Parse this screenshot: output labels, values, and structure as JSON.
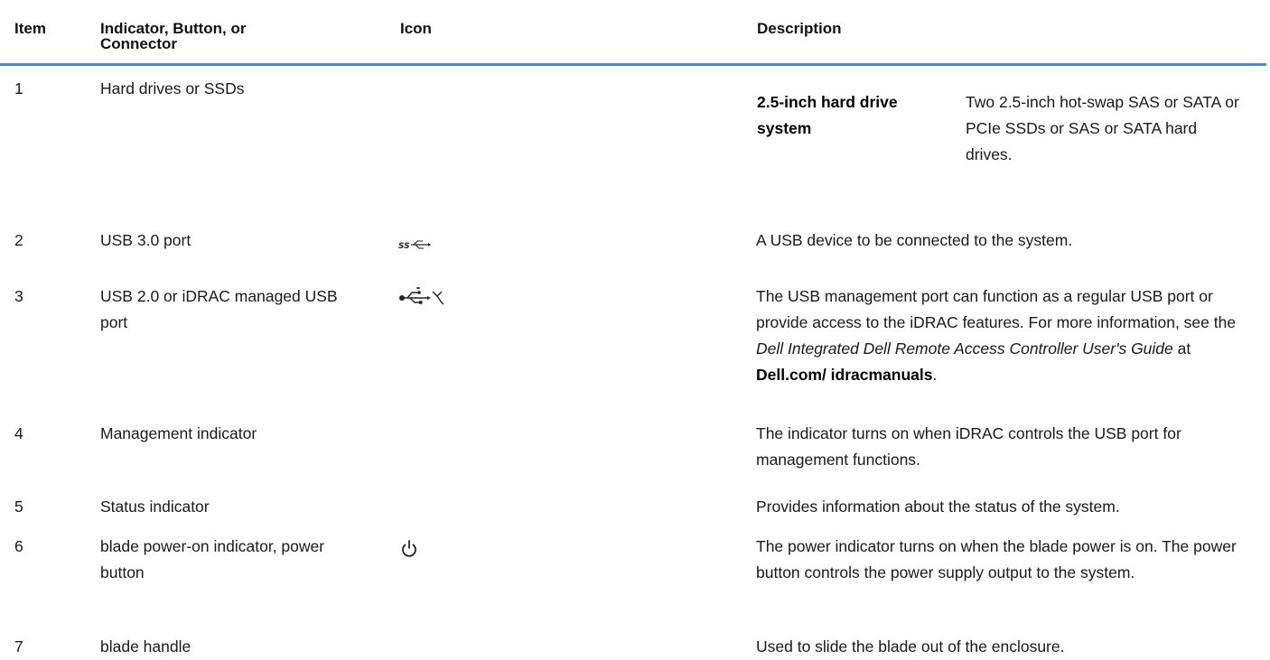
{
  "headers": {
    "item": "Item",
    "indicator": "Indicator, Button, or Connector",
    "icon": "Icon",
    "description": "Description"
  },
  "rows": [
    {
      "item": "1",
      "indicator": "Hard drives or SSDs",
      "icon": "",
      "sub_label": "2.5-inch hard drive system",
      "sub_text": "Two 2.5-inch hot-swap SAS or SATA or PCIe SSDs or SAS or SATA hard drives."
    },
    {
      "item": "2",
      "indicator": "USB 3.0 port",
      "icon": "usb-superspeed-icon",
      "description": "A USB device to be connected to the system."
    },
    {
      "item": "3",
      "indicator": "USB 2.0 or iDRAC managed USB port",
      "icon": "usb-idrac-icon",
      "description_parts": {
        "pre": "The USB management port can function as a regular USB port or provide access to the iDRAC features. For more information, see the ",
        "italic": "Dell Integrated Dell Remote Access Controller User's Guide",
        "mid": " at ",
        "bold": "Dell.com/ idracmanuals",
        "post": "."
      }
    },
    {
      "item": "4",
      "indicator": "Management indicator",
      "icon": "",
      "description": "The indicator turns on when iDRAC controls the USB port for management functions."
    },
    {
      "item": "5",
      "indicator": "Status indicator",
      "icon": "",
      "description": "Provides information about the status of the system."
    },
    {
      "item": "6",
      "indicator": "blade power-on indicator, power button",
      "icon": "power-icon",
      "description": "The power indicator turns on when the blade power is on. The power button controls the power supply output to the system."
    },
    {
      "item": "7",
      "indicator": "blade handle",
      "icon": "",
      "description": "Used to slide the blade out of the enclosure."
    }
  ]
}
